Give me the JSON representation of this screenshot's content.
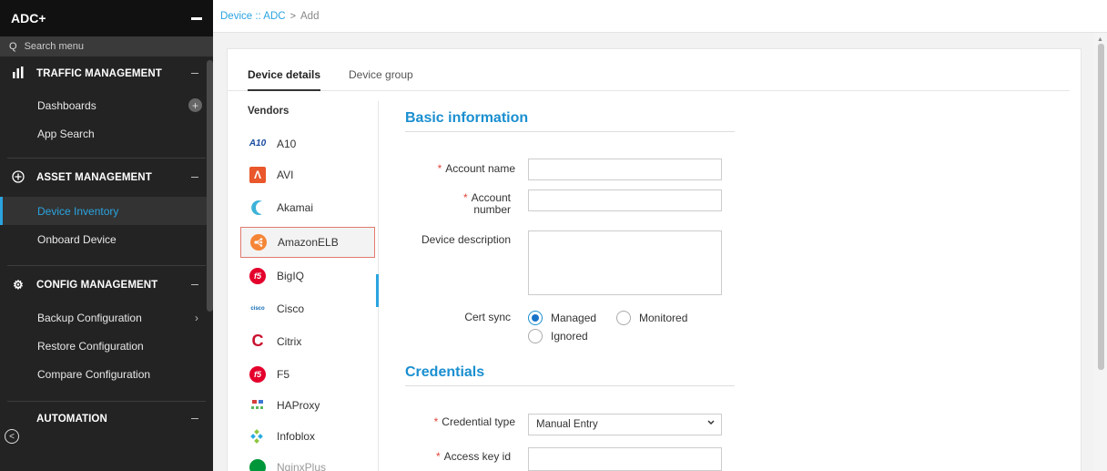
{
  "app": {
    "title": "ADC+"
  },
  "search": {
    "placeholder": "Search menu"
  },
  "sidebar": {
    "sections": [
      {
        "label": "TRAFFIC MANAGEMENT",
        "icon": "bar-chart-icon",
        "items": [
          {
            "label": "Dashboards"
          },
          {
            "label": "App Search"
          }
        ]
      },
      {
        "label": "ASSET MANAGEMENT",
        "icon": "plus-circle-icon",
        "items": [
          {
            "label": "Device Inventory"
          },
          {
            "label": "Onboard Device"
          }
        ]
      },
      {
        "label": "CONFIG MANAGEMENT",
        "icon": "gear-group-icon",
        "items": [
          {
            "label": "Backup Configuration"
          },
          {
            "label": "Restore Configuration"
          },
          {
            "label": "Compare Configuration"
          }
        ]
      },
      {
        "label": "AUTOMATION",
        "icon": "automation-icon",
        "items": []
      }
    ],
    "active_item": "Device Inventory"
  },
  "breadcrumb": {
    "link": "Device :: ADC",
    "separator": ">",
    "current": "Add"
  },
  "tabs": [
    {
      "label": "Device details"
    },
    {
      "label": "Device group"
    }
  ],
  "vendors": {
    "heading": "Vendors",
    "selected": "AmazonELB",
    "items": [
      {
        "label": "A10",
        "icon": "a10-logo-icon",
        "logo_text": "A10"
      },
      {
        "label": "AVI",
        "icon": "avi-logo-icon",
        "logo_text": "Λ"
      },
      {
        "label": "Akamai",
        "icon": "akamai-logo-icon",
        "logo_text": ""
      },
      {
        "label": "AmazonELB",
        "icon": "amazon-elb-logo-icon",
        "logo_text": ""
      },
      {
        "label": "BigIQ",
        "icon": "f5-logo-icon",
        "logo_text": "f5"
      },
      {
        "label": "Cisco",
        "icon": "cisco-logo-icon",
        "logo_text": "cisco"
      },
      {
        "label": "Citrix",
        "icon": "citrix-logo-icon",
        "logo_text": "C"
      },
      {
        "label": "F5",
        "icon": "f5-logo-icon",
        "logo_text": "f5"
      },
      {
        "label": "HAProxy",
        "icon": "haproxy-logo-icon",
        "logo_text": ""
      },
      {
        "label": "Infoblox",
        "icon": "infoblox-logo-icon",
        "logo_text": ""
      },
      {
        "label": "NginxPlus",
        "icon": "nginx-logo-icon",
        "logo_text": ""
      }
    ]
  },
  "form": {
    "basic_title": "Basic information",
    "account_name_label": "Account name",
    "account_number_label_1": "Account",
    "account_number_label_2": "number",
    "description_label": "Device description",
    "cert_sync_label": "Cert sync",
    "cert_options": [
      "Managed",
      "Monitored",
      "Ignored"
    ],
    "cert_selected": "Managed",
    "credentials_title": "Credentials",
    "credential_type_label": "Credential type",
    "credential_type_value": "Manual Entry",
    "access_key_label": "Access key id",
    "required_mark": "*"
  },
  "colors": {
    "accent": "#2aa4e0",
    "section_title": "#1a8fd0",
    "required": "#e0453a",
    "sidebar_bg": "#232323"
  }
}
